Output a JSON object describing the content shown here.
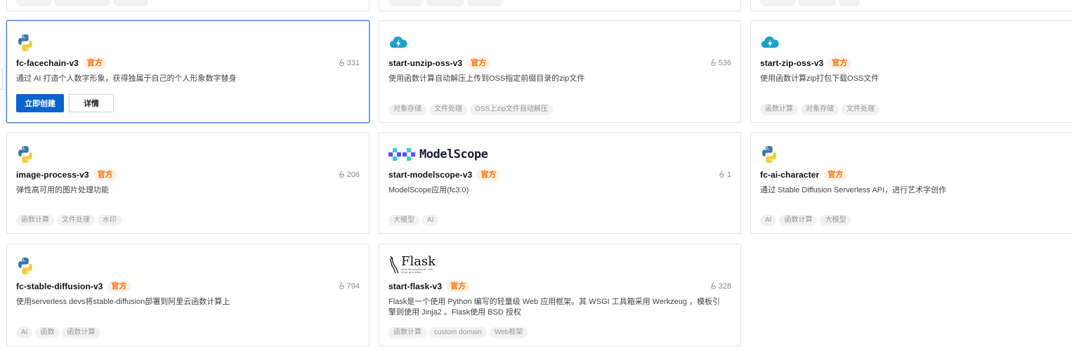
{
  "cards": [
    {
      "id": "facechain",
      "title": "fc-facechain-v3",
      "badge": "官方",
      "likes": "331",
      "desc": "通过 AI 打造个人数字形象，获得独属于自己的个人形象数字替身",
      "tags": [],
      "buttons": {
        "create": "立即创建",
        "details": "详情"
      },
      "logo": "python-icon"
    },
    {
      "id": "unzip",
      "title": "start-unzip-oss-v3",
      "badge": "官方",
      "likes": "536",
      "desc": "使用函数计算自动解压上传到OSS指定前缀目录的zip文件",
      "tags": [
        "对象存储",
        "文件处理",
        "OSS上zip文件自动解压"
      ],
      "logo": "cloud-bolt-icon"
    },
    {
      "id": "zip",
      "title": "start-zip-oss-v3",
      "badge": "官方",
      "likes": "",
      "desc": "使用函数计算zip打包下载OSS文件",
      "tags": [
        "函数计算",
        "对象存储",
        "文件处理"
      ],
      "logo": "cloud-bolt-icon"
    },
    {
      "id": "imgproc",
      "title": "image-process-v3",
      "badge": "官方",
      "likes": "206",
      "desc": "弹性高可用的图片处理功能",
      "tags": [
        "函数计算",
        "文件处理",
        "水印"
      ],
      "logo": "python-icon"
    },
    {
      "id": "modelscope",
      "title": "start-modelscope-v3",
      "badge": "官方",
      "likes": "1",
      "desc": "ModelScope应用(fc3.0)",
      "tags": [
        "大模型",
        "AI"
      ],
      "logo": "modelscope-logo",
      "logo_text": "ModelScope"
    },
    {
      "id": "aichar",
      "title": "fc-ai-character",
      "badge": "官方",
      "likes": "",
      "desc": "通过 Stable Diffusion Serverless API，进行艺术字创作",
      "tags": [
        "AI",
        "函数计算",
        "大模型"
      ],
      "logo": "python-icon"
    },
    {
      "id": "sd",
      "title": "fc-stable-diffusion-v3",
      "badge": "官方",
      "likes": "794",
      "desc": "使用serverless devs将stable-diffusion部署到阿里云函数计算上",
      "tags": [
        "AI",
        "函数",
        "函数计算"
      ],
      "logo": "python-icon"
    },
    {
      "id": "flask",
      "title": "start-flask-v3",
      "badge": "官方",
      "likes": "328",
      "desc": "Flask是一个使用 Python 编写的轻量级 Web 应用框架。其 WSGI 工具箱采用 Werkzeug ，模板引擎则使用 Jinja2 。Flask使用 BSD 授权",
      "tags": [
        "函数计算",
        "custom domain",
        "Web框架"
      ],
      "logo": "flask-logo",
      "logo_text": "Flask",
      "logo_sub": "web development, one drop at a time"
    }
  ],
  "colors": {
    "primary": "#0a64d0",
    "badge": "#ff6a00",
    "badge_bg": "#fff1e6",
    "active_border": "#4a86d6"
  }
}
